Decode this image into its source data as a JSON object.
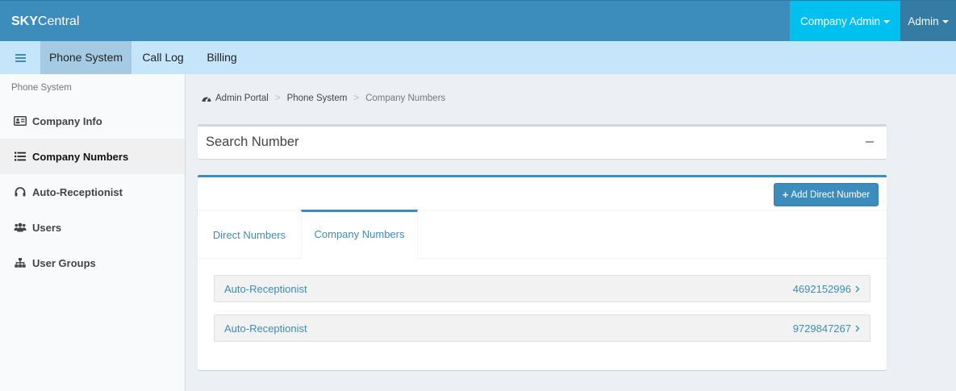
{
  "topbar": {
    "brand_bold": "SKY",
    "brand_rest": "Central",
    "company_admin": "Company Admin",
    "admin": "Admin",
    "colors": {
      "bar": "#3c8dbc",
      "company_admin": "#00c0ef",
      "admin": "#357ca5"
    }
  },
  "menubar": {
    "items": [
      {
        "label": "Phone System",
        "active": true
      },
      {
        "label": "Call Log",
        "active": false
      },
      {
        "label": "Billing",
        "active": false
      }
    ]
  },
  "sidebar": {
    "header": "Phone System",
    "items": [
      {
        "label": "Company Info",
        "icon": "id-card-icon",
        "active": false
      },
      {
        "label": "Company Numbers",
        "icon": "list-icon",
        "active": true
      },
      {
        "label": "Auto-Receptionist",
        "icon": "headphones-icon",
        "active": false
      },
      {
        "label": "Users",
        "icon": "users-icon",
        "active": false
      },
      {
        "label": "User Groups",
        "icon": "sitemap-icon",
        "active": false
      }
    ]
  },
  "breadcrumb": {
    "items": [
      "Admin Portal",
      "Phone System",
      "Company Numbers"
    ],
    "separator": ">"
  },
  "search_panel": {
    "title": "Search Number"
  },
  "numbers_panel": {
    "add_button": "Add Direct Number",
    "tabs": [
      {
        "label": "Direct Numbers",
        "active": false
      },
      {
        "label": "Company Numbers",
        "active": true
      }
    ],
    "rows": [
      {
        "label": "Auto-Receptionist",
        "number": "4692152996"
      },
      {
        "label": "Auto-Receptionist",
        "number": "9729847267"
      }
    ]
  }
}
